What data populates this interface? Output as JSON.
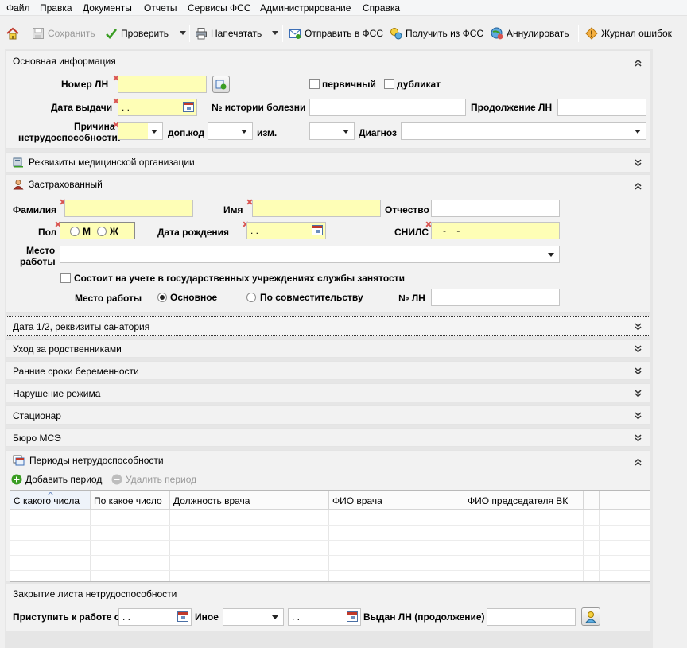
{
  "menu": [
    "Файл",
    "Правка",
    "Документы",
    "Отчеты",
    "Сервисы ФСС",
    "Администрирование",
    "Справка"
  ],
  "toolbar": {
    "save": "Сохранить",
    "check": "Проверить",
    "print": "Напечатать",
    "send": "Отправить в ФСС",
    "receive": "Получить из ФСС",
    "cancel": "Аннулировать",
    "error_log": "Журнал ошибок"
  },
  "main_info": {
    "title": "Основная информация",
    "ln_number_label": "Номер ЛН",
    "ln_number_value": "",
    "primary_label": "первичный",
    "duplicate_label": "дубликат",
    "issue_date_label": "Дата выдачи",
    "issue_date_value": " .  .",
    "history_label": "№ истории болезни",
    "history_value": "",
    "continuation_label": "Продолжение ЛН",
    "continuation_value": "",
    "reason_label_1": "Причина",
    "reason_label_2": "нетрудоспособности:",
    "reason_value": "",
    "add_code_label": "доп.код",
    "add_code_value": "",
    "change_label": "изм.",
    "change_value": "",
    "diagnosis_label": "Диагноз",
    "diagnosis_value": ""
  },
  "med_org": {
    "title": "Реквизиты медицинской организации"
  },
  "insured": {
    "title": "Застрахованный",
    "surname_label": "Фамилия",
    "surname_value": "",
    "name_label": "Имя",
    "name_value": "",
    "patronymic_label": "Отчество",
    "patronymic_value": "",
    "gender_label": "Пол",
    "gender_m": "М",
    "gender_f": "Ж",
    "birth_label": "Дата рождения",
    "birth_value": " .  .",
    "snils_label": "СНИЛС",
    "snils_value": "   -    -",
    "workplace_label_1": "Место",
    "workplace_label_2": "работы",
    "workplace_value": "",
    "employment_label": "Состоит на учете в государственных учреждениях службы занятости",
    "work_type_label": "Место работы",
    "main_work": "Основное",
    "part_time": "По совместительству",
    "ln_no_label": "№ ЛН",
    "ln_no_value": ""
  },
  "collapsed_sections": [
    "Дата 1/2, реквизиты санатория",
    "Уход за родственниками",
    "Ранние сроки беременности",
    "Нарушение режима",
    "Стационар",
    "Бюро МСЭ"
  ],
  "periods": {
    "title": "Периоды нетрудоспособности",
    "add": "Добавить период",
    "delete": "Удалить период",
    "columns": [
      "С какого числа",
      "По какое число",
      "Должность врача",
      "ФИО врача",
      "",
      "ФИО председателя ВК",
      ""
    ]
  },
  "closing": {
    "title": "Закрытие листа нетрудоспособности",
    "start_work_label": "Приступить к работе с",
    "start_work_value": " .  .",
    "other_label": "Иное",
    "other_value": "",
    "other_date_value": " .  .",
    "issued_label": "Выдан ЛН (продолжение)",
    "issued_value": ""
  },
  "colors": {
    "required": "#fefeb6",
    "panel": "#f2f2f2",
    "background": "#e6e6e6"
  }
}
